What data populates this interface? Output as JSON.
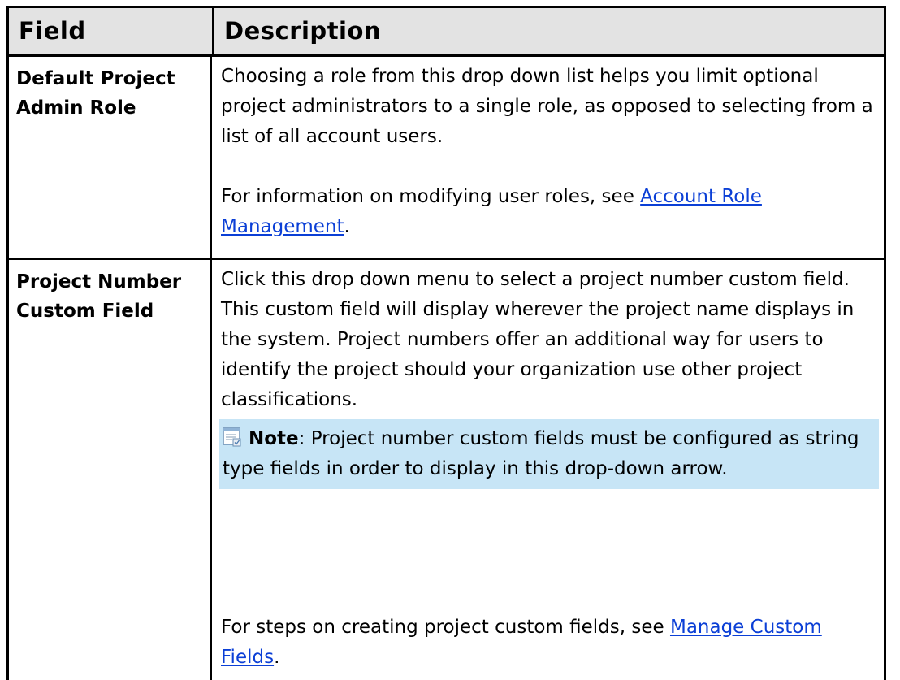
{
  "table": {
    "headers": {
      "field": "Field",
      "description": "Description"
    },
    "rows": [
      {
        "field": "Default Project Admin Role",
        "paragraph1": "Choosing a role from this drop down list helps you limit optional project administrators to a single role, as opposed to selecting from a list of all account users.",
        "paragraph2_prefix": "For information on modifying user roles, see ",
        "paragraph2_link": "Account Role Management",
        "paragraph2_suffix": "."
      },
      {
        "field": "Project Number Custom Field",
        "paragraph1": "Click this drop down menu to select a project number custom field. This custom field will display wherever the project name displays in the system. Project numbers offer an additional way for users to identify the project should your organization use other project classifications.",
        "note_label": "Note",
        "note_text": ": Project number custom fields must be configured as string type fields in order to display in this drop-down arrow.",
        "paragraph2_prefix": "For steps on creating project custom fields, see ",
        "paragraph2_link": "Manage Custom Fields",
        "paragraph2_suffix": "."
      }
    ]
  },
  "colors": {
    "header_bg": "#e3e3e3",
    "note_bg": "#c7e5f6",
    "link": "#0b3fd6"
  },
  "icons": {
    "note": "note-icon"
  }
}
